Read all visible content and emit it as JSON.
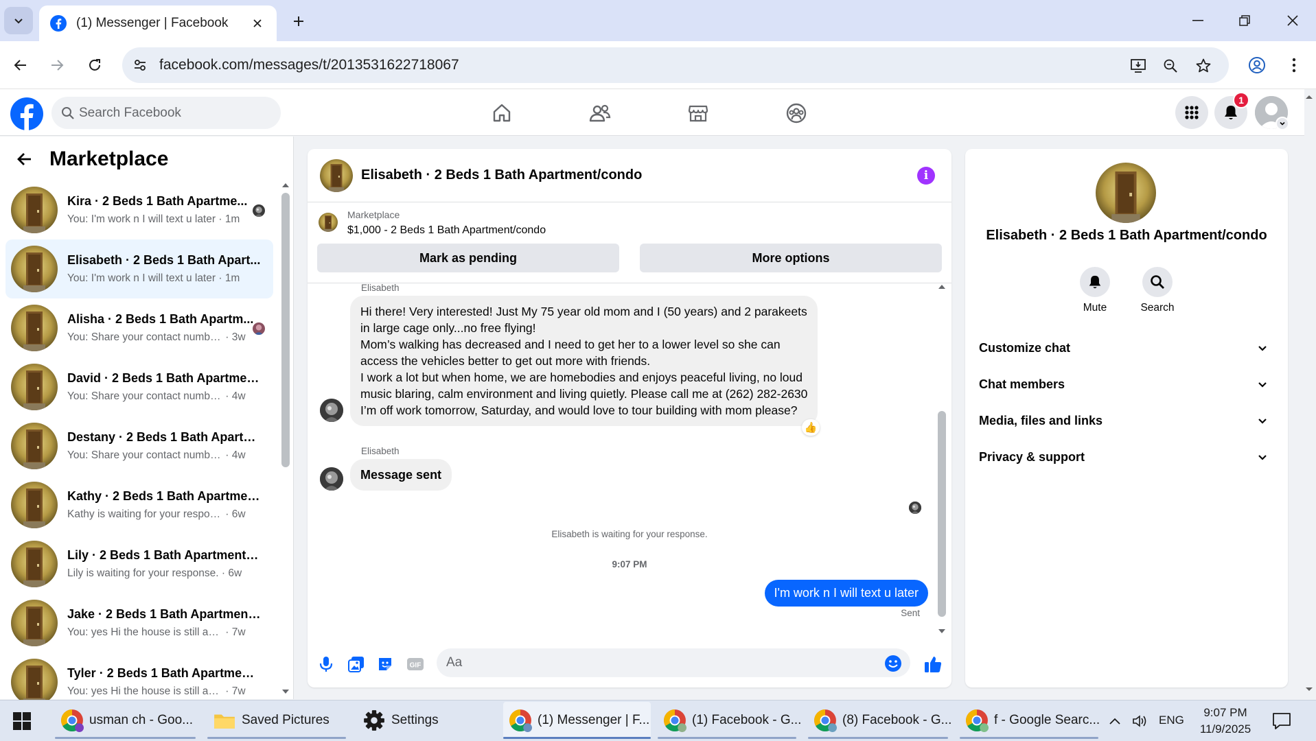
{
  "browser": {
    "tab_title": "(1) Messenger | Facebook",
    "url": "facebook.com/messages/t/2013531622718067"
  },
  "fb_header": {
    "search_placeholder": "Search Facebook",
    "notification_count": "1"
  },
  "sidebar": {
    "title": "Marketplace",
    "conversations": [
      {
        "name": "Kira · 2 Beds 1 Bath Apartme...",
        "preview": "You: I'm work n I will text u later",
        "time": "1m",
        "seen": true,
        "active": false
      },
      {
        "name": "Elisabeth · 2 Beds 1 Bath Apart...",
        "preview": "You: I'm work n I will text u later",
        "time": "1m",
        "seen": false,
        "active": true
      },
      {
        "name": "Alisha · 2 Beds 1 Bath Apartm...",
        "preview": "You: Share your contact numbe...",
        "time": "3w",
        "seen": true,
        "active": false
      },
      {
        "name": "David · 2 Beds 1 Bath Apartmen...",
        "preview": "You: Share your contact number a...",
        "time": "4w",
        "seen": false,
        "active": false
      },
      {
        "name": "Destany · 2 Beds 1 Bath Apartm...",
        "preview": "You: Share your contact number a...",
        "time": "4w",
        "seen": false,
        "active": false
      },
      {
        "name": "Kathy · 2 Beds 1 Bath Apartmen...",
        "preview": "Kathy is waiting for your response.",
        "time": "6w",
        "seen": false,
        "active": false
      },
      {
        "name": "Lily · 2 Beds 1 Bath Apartment/c...",
        "preview": "Lily is waiting for your response.",
        "time": "6w",
        "seen": false,
        "active": false
      },
      {
        "name": "Jake · 2 Beds 1 Bath Apartment/...",
        "preview": "You: yes Hi the house is still availa...",
        "time": "7w",
        "seen": false,
        "active": false
      },
      {
        "name": "Tyler · 2 Beds 1 Bath Apartment...",
        "preview": "You: yes Hi the house is still availa...",
        "time": "7w",
        "seen": false,
        "active": false
      }
    ]
  },
  "chat": {
    "title": "Elisabeth · 2 Beds 1 Bath Apartment/condo",
    "marketplace_label": "Marketplace",
    "listing": "$1,000 - 2 Beds 1 Bath Apartment/condo",
    "btn_pending": "Mark as pending",
    "btn_more": "More options",
    "sender_name": "Elisabeth",
    "msg1_lines": [
      "Hi there! Very interested! Just My 75 year old mom and I (50 years) and 2 parakeets",
      "in large cage only...no free flying!",
      "Mom’s walking has decreased and I need to get her to a lower level so she can",
      "access the vehicles better to get out more with friends.",
      "I work a lot but when home, we are homebodies and enjoys peaceful living, no loud",
      "music blaring, calm environment and living quietly. Please call me at (262) 282-2630",
      "I’m off work tomorrow, Saturday, and would love to tour building with mom please?"
    ],
    "msg1_reaction": "👍",
    "msg2": "Message sent",
    "waiting_note": "Elisabeth is waiting for your response.",
    "time_note": "9:07 PM",
    "out_msg": "I'm work n I will text u later",
    "sent_label": "Sent",
    "composer_placeholder": "Aa"
  },
  "info_panel": {
    "name": "Elisabeth · 2 Beds 1 Bath Apartment/condo",
    "mute_label": "Mute",
    "search_label": "Search",
    "rows": [
      "Customize chat",
      "Chat members",
      "Media, files and links",
      "Privacy & support"
    ]
  },
  "taskbar": {
    "items": [
      {
        "label": "usman ch - Goo...",
        "icon": "chrome-icon"
      },
      {
        "label": "Saved Pictures",
        "icon": "folder-icon"
      },
      {
        "label": "Settings",
        "icon": "gear-icon"
      },
      {
        "label": "(1) Messenger | F...",
        "icon": "chrome-icon"
      },
      {
        "label": "(1) Facebook - G...",
        "icon": "chrome-icon"
      },
      {
        "label": "(8) Facebook - G...",
        "icon": "chrome-icon"
      },
      {
        "label": "f - Google Searc...",
        "icon": "chrome-icon"
      }
    ],
    "lang": "ENG",
    "time": "9:07 PM",
    "date": "11/9/2025"
  },
  "colors": {
    "fb_blue": "#0866ff",
    "info_purple": "#a033ff",
    "badge_red": "#e41e3f",
    "active_row": "#ebf5ff"
  }
}
